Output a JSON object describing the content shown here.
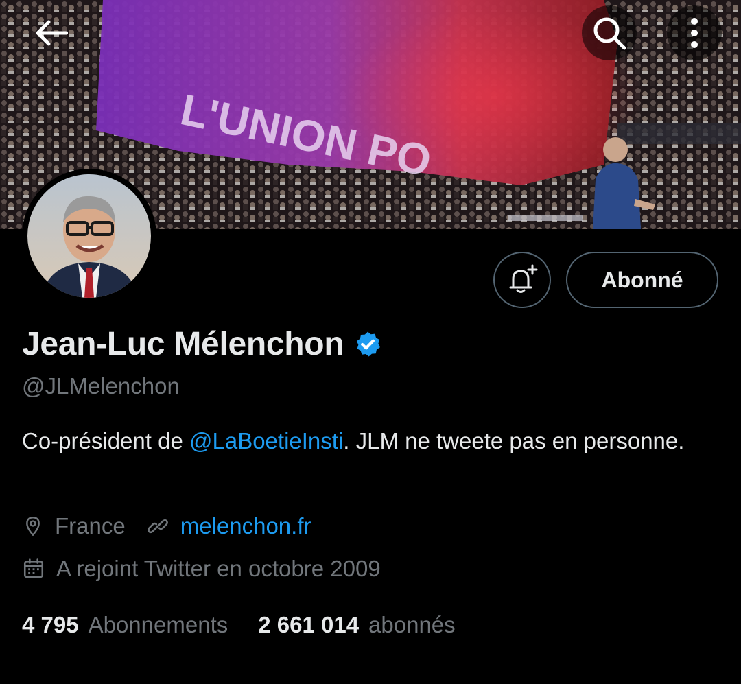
{
  "header": {
    "back_icon": "arrow-left-icon",
    "search_icon": "search-icon",
    "more_icon": "more-vertical-icon"
  },
  "profile": {
    "display_name": "Jean-Luc Mélenchon",
    "verified_icon": "verified-badge-icon",
    "handle": "@JLMelenchon",
    "bio_prefix": "Co-président de ",
    "bio_mention": "@LaBoetieInsti",
    "bio_suffix": ". JLM ne tweete pas en personne.",
    "location": "France",
    "website": "melenchon.fr",
    "joined": "A rejoint Twitter en octobre 2009"
  },
  "actions": {
    "notify_icon": "bell-plus-icon",
    "follow_label": "Abonné"
  },
  "stats": {
    "following_count": "4 795",
    "following_label": "Abonnements",
    "followers_count": "2 661 014",
    "followers_label": "abonnés"
  },
  "banner": {
    "flag_text": "L'UNION PO"
  },
  "colors": {
    "background": "#000000",
    "text_primary": "#e7e9ea",
    "text_secondary": "#71767b",
    "link": "#1d9bf0",
    "border": "#536471"
  }
}
